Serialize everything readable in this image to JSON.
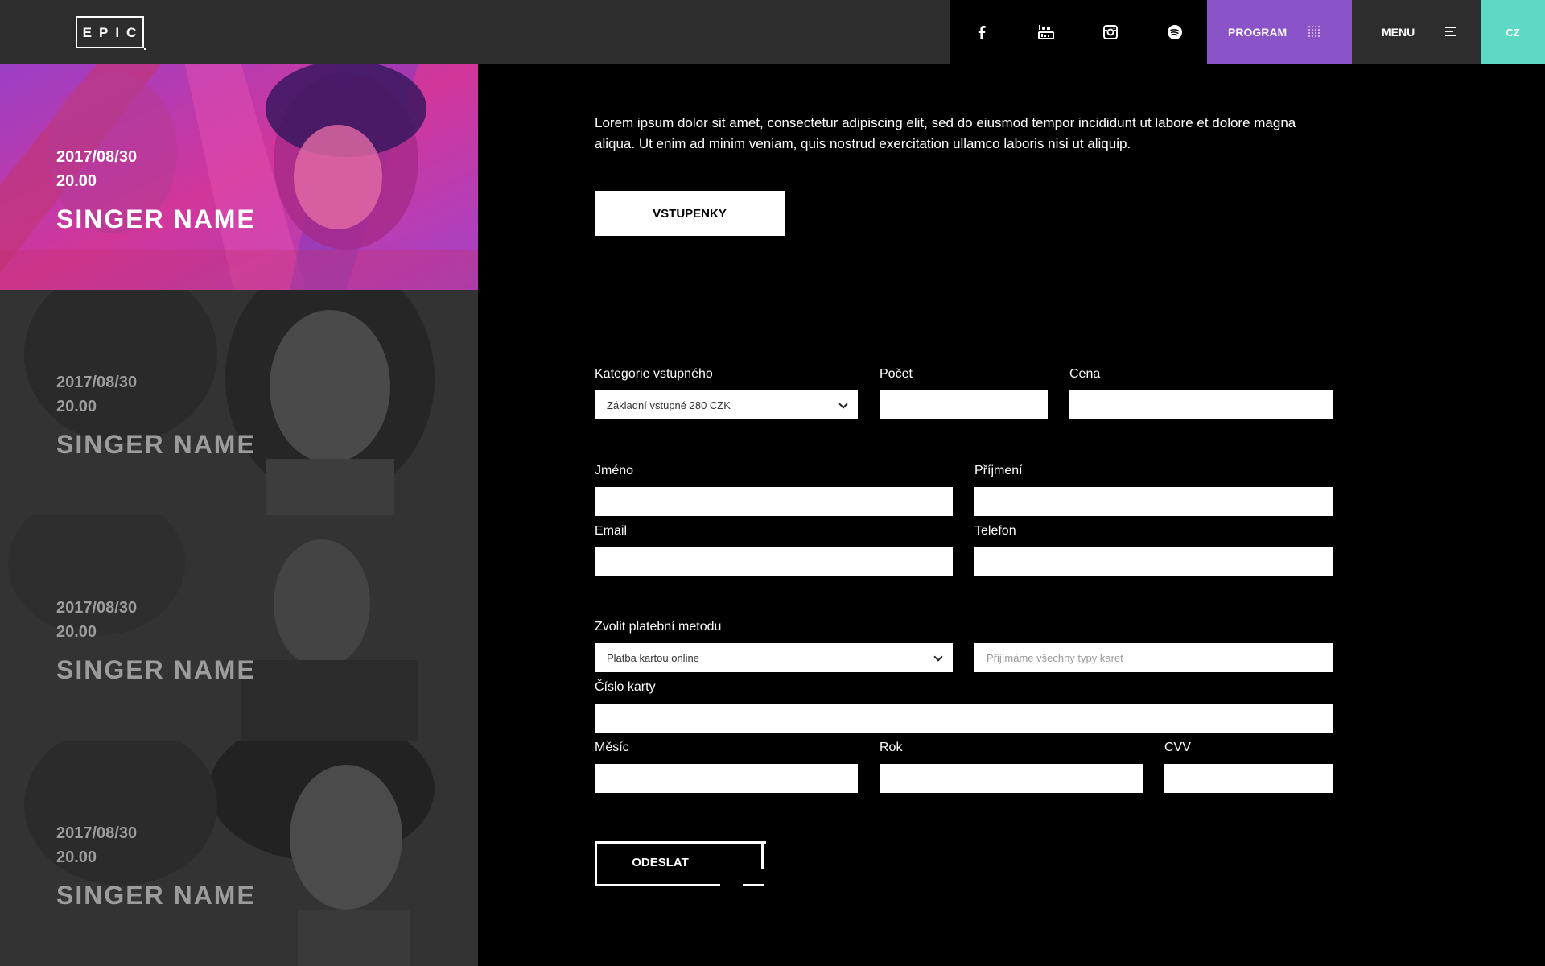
{
  "header": {
    "logo_text": "EPIC",
    "social": [
      {
        "icon": "facebook-icon"
      },
      {
        "icon": "youtube-icon"
      },
      {
        "icon": "instagram-icon"
      },
      {
        "icon": "spotify-icon"
      }
    ],
    "program_label": "PROGRAM",
    "menu_label": "MENU",
    "lang_label": "CZ",
    "colors": {
      "program": "#8a53c8",
      "lang": "#5fd9c6"
    }
  },
  "events": [
    {
      "date": "2017/08/30",
      "time": "20.00",
      "name": "SINGER NAME",
      "active": true
    },
    {
      "date": "2017/08/30",
      "time": "20.00",
      "name": "SINGER NAME",
      "active": false
    },
    {
      "date": "2017/08/30",
      "time": "20.00",
      "name": "SINGER NAME",
      "active": false
    },
    {
      "date": "2017/08/30",
      "time": "20.00",
      "name": "SINGER NAME",
      "active": false
    }
  ],
  "main": {
    "intro": "Lorem ipsum dolor sit amet, consectetur adipiscing elit, sed do eiusmod tempor incididunt ut labore et dolore magna aliqua. Ut enim ad minim veniam, quis nostrud exercitation ullamco laboris nisi ut aliquip.",
    "tickets_button": "VSTUPENKY",
    "form": {
      "category_label": "Kategorie vstupného",
      "category_value": "Základní vstupné 280 CZK",
      "count_label": "Počet",
      "price_label": "Cena",
      "first_name_label": "Jméno",
      "last_name_label": "Příjmení",
      "email_label": "Email",
      "phone_label": "Telefon",
      "payment_label": "Zvolit platební metodu",
      "payment_value": "Platba kartou online",
      "cards_placeholder": "Přijímáme všechny typy karet",
      "card_number_label": "Číslo karty",
      "month_label": "Měsíc",
      "year_label": "Rok",
      "cvv_label": "CVV",
      "submit_label": "ODESLAT"
    }
  }
}
